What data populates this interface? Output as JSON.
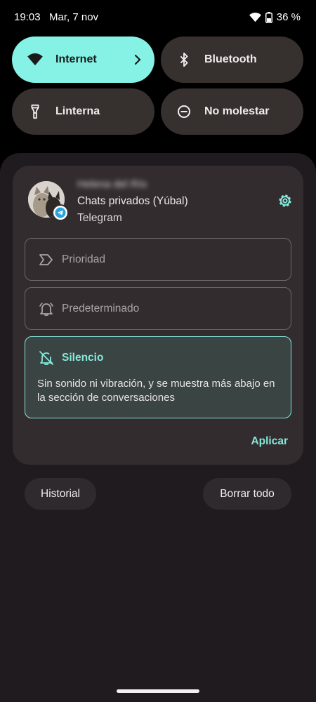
{
  "status_bar": {
    "time": "19:03",
    "date": "Mar, 7 nov",
    "battery_percent": "36 %"
  },
  "quick_tiles": [
    {
      "label": "Internet",
      "icon": "wifi-icon",
      "active": true,
      "has_chevron": true
    },
    {
      "label": "Bluetooth",
      "icon": "bluetooth-icon",
      "active": false
    },
    {
      "label": "Linterna",
      "icon": "flashlight-icon",
      "active": false
    },
    {
      "label": "No molestar",
      "icon": "do-not-disturb-icon",
      "active": false
    }
  ],
  "notification": {
    "sender": "Helena del Río",
    "chat_name": "Chats privados (Yúbal)",
    "app_name": "Telegram",
    "options": [
      {
        "label": "Prioridad",
        "icon": "priority-icon",
        "selected": false
      },
      {
        "label": "Predeterminado",
        "icon": "bell-icon",
        "selected": false
      },
      {
        "label": "Silencio",
        "icon": "bell-off-icon",
        "selected": true,
        "description": "Sin sonido ni vibración, y se muestra más abajo en la sección de conversaciones"
      }
    ],
    "apply_label": "Aplicar"
  },
  "footer": {
    "history_label": "Historial",
    "clear_all_label": "Borrar todo"
  },
  "colors": {
    "accent": "#86f2e6",
    "accent_text": "#86e8db",
    "tile_bg": "#36302f",
    "shade_bg": "#201b1e",
    "card_bg": "#322c2f"
  }
}
